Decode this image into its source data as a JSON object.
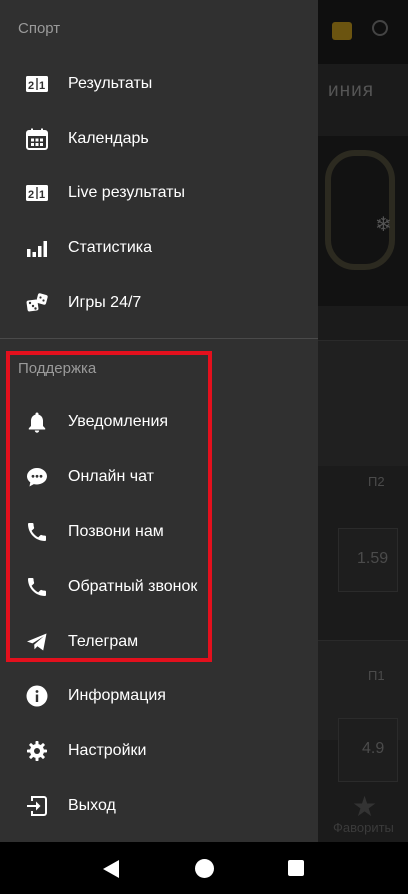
{
  "background": {
    "title_fragment": "иния",
    "odds_1": "1.59",
    "odds_2": "4.9",
    "col_header_1": "П2",
    "col_header_2": "П1",
    "favorites_label": "Фавориты"
  },
  "drawer": {
    "sport_section": "Спорт",
    "sport_items": [
      {
        "label": "Результаты",
        "icon": "scoreboard-icon"
      },
      {
        "label": "Календарь",
        "icon": "calendar-icon"
      },
      {
        "label": "Live результаты",
        "icon": "live-scoreboard-icon"
      },
      {
        "label": "Статистика",
        "icon": "bar-chart-icon"
      },
      {
        "label": "Игры 24/7",
        "icon": "dice-icon"
      }
    ],
    "support_section": "Поддержка",
    "support_items": [
      {
        "label": "Уведомления",
        "icon": "bell-icon"
      },
      {
        "label": "Онлайн чат",
        "icon": "chat-bubble-icon"
      },
      {
        "label": "Позвони нам",
        "icon": "phone-icon"
      },
      {
        "label": "Обратный звонок",
        "icon": "phone-callback-icon"
      },
      {
        "label": "Телеграм",
        "icon": "telegram-icon"
      }
    ],
    "other_items": [
      {
        "label": "Информация",
        "icon": "info-icon"
      },
      {
        "label": "Настройки",
        "icon": "gear-icon"
      },
      {
        "label": "Выход",
        "icon": "logout-icon"
      }
    ]
  },
  "colors": {
    "drawer_bg": "#303030",
    "highlight_border": "#e3101d",
    "text": "#ffffff",
    "section_label": "#9a9a9a"
  }
}
